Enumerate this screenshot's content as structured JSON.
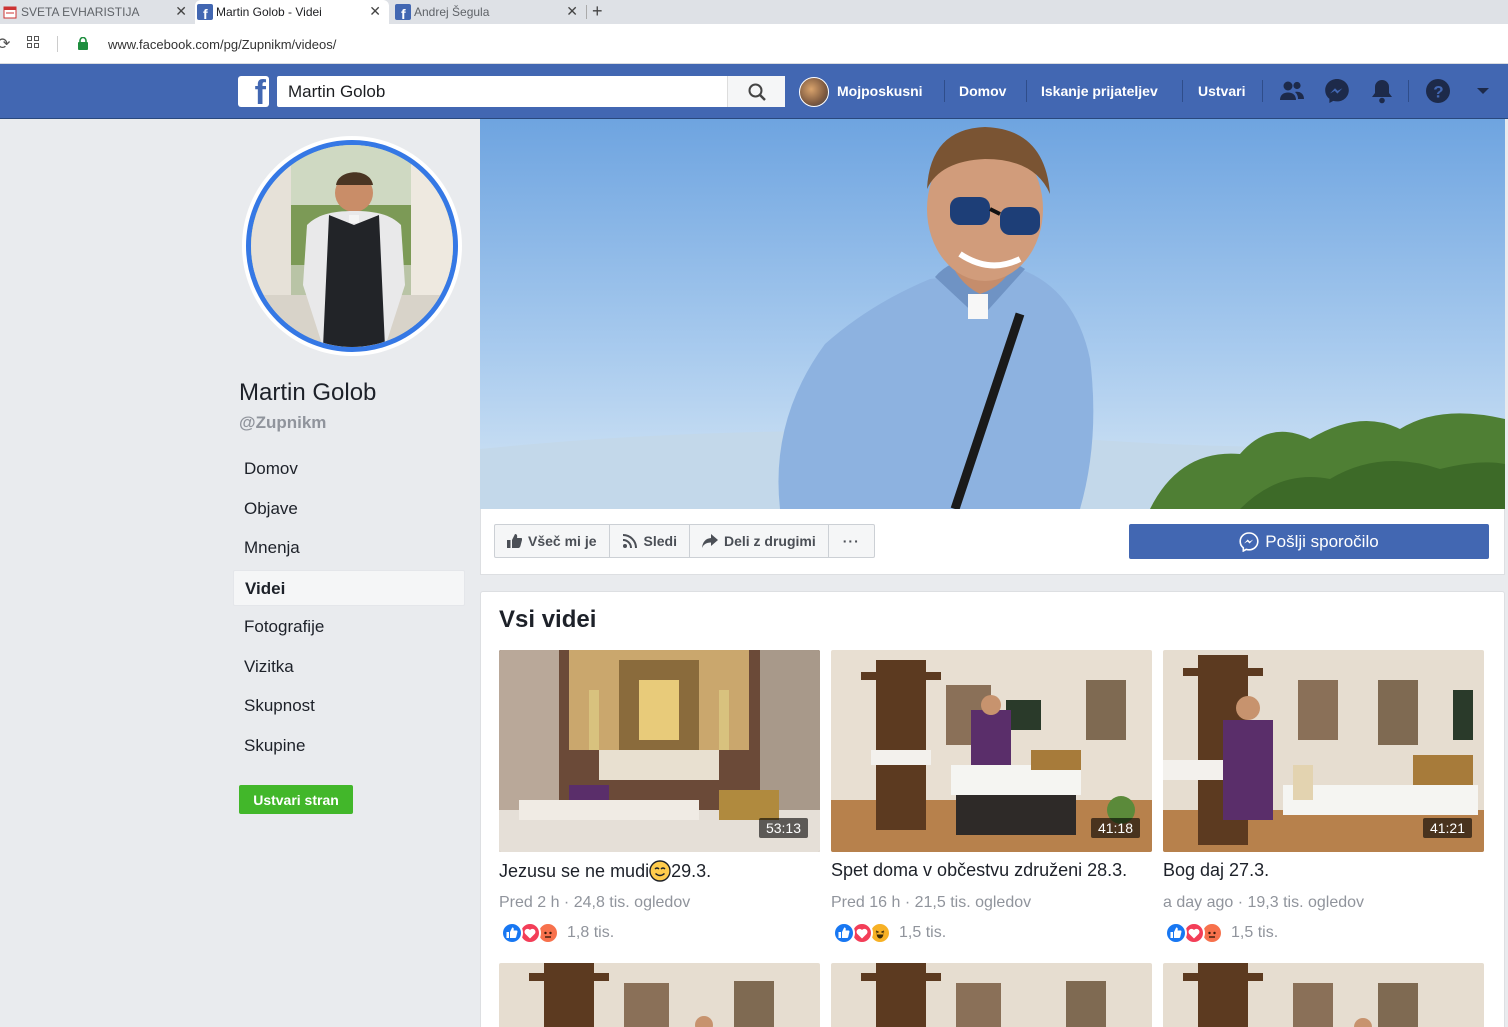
{
  "browser": {
    "tabs": [
      {
        "title": "SVETA EVHARISTIJA",
        "active": false
      },
      {
        "title": "Martin Golob - Videi",
        "active": true
      },
      {
        "title": "Andrej Šegula",
        "active": false
      }
    ],
    "new_tab": "+",
    "close_glyph": "✕",
    "url": "www.facebook.com/pg/Zupnikm/videos/"
  },
  "fb": {
    "search_value": "Martin Golob",
    "nav": {
      "profile": "Mojposkusni",
      "home": "Domov",
      "find_friends": "Iskanje prijateljev",
      "create": "Ustvari"
    },
    "colors": {
      "bar": "#4267b2",
      "accent": "#3578e5",
      "green": "#42b72a"
    }
  },
  "page": {
    "name": "Martin Golob",
    "handle": "@Zupnikm",
    "nav": [
      {
        "label": "Domov",
        "active": false
      },
      {
        "label": "Objave",
        "active": false
      },
      {
        "label": "Mnenja",
        "active": false
      },
      {
        "label": "Videi",
        "active": true
      },
      {
        "label": "Fotografije",
        "active": false
      },
      {
        "label": "Vizitka",
        "active": false
      },
      {
        "label": "Skupnost",
        "active": false
      },
      {
        "label": "Skupine",
        "active": false
      }
    ],
    "create_page": "Ustvari stran"
  },
  "actions": {
    "like": "Všeč mi je",
    "follow": "Sledi",
    "share": "Deli z drugimi",
    "more": "···",
    "message": "Pošlji sporočilo"
  },
  "videos": {
    "heading": "Vsi videi",
    "items": [
      {
        "title": "Jezusu se ne mudi ",
        "title_suffix": "29.3.",
        "emoji": "smiling-face-icon",
        "duration": "53:13",
        "meta": "Pred 2 h · 24,8 tis. ogledov",
        "reactions": [
          "like",
          "love",
          "angry"
        ],
        "reaction_count": "1,8 tis."
      },
      {
        "title": "Spet doma v občestvu združeni 28.3.",
        "title_suffix": "",
        "duration": "41:18",
        "meta": "Pred 16 h · 21,5 tis. ogledov",
        "reactions": [
          "like",
          "love",
          "haha"
        ],
        "reaction_count": "1,5 tis."
      },
      {
        "title": "Bog daj 27.3.",
        "title_suffix": "",
        "duration": "41:21",
        "meta": "a day ago · 19,3 tis. ogledov",
        "reactions": [
          "like",
          "love",
          "angry"
        ],
        "reaction_count": "1,5 tis."
      }
    ]
  }
}
